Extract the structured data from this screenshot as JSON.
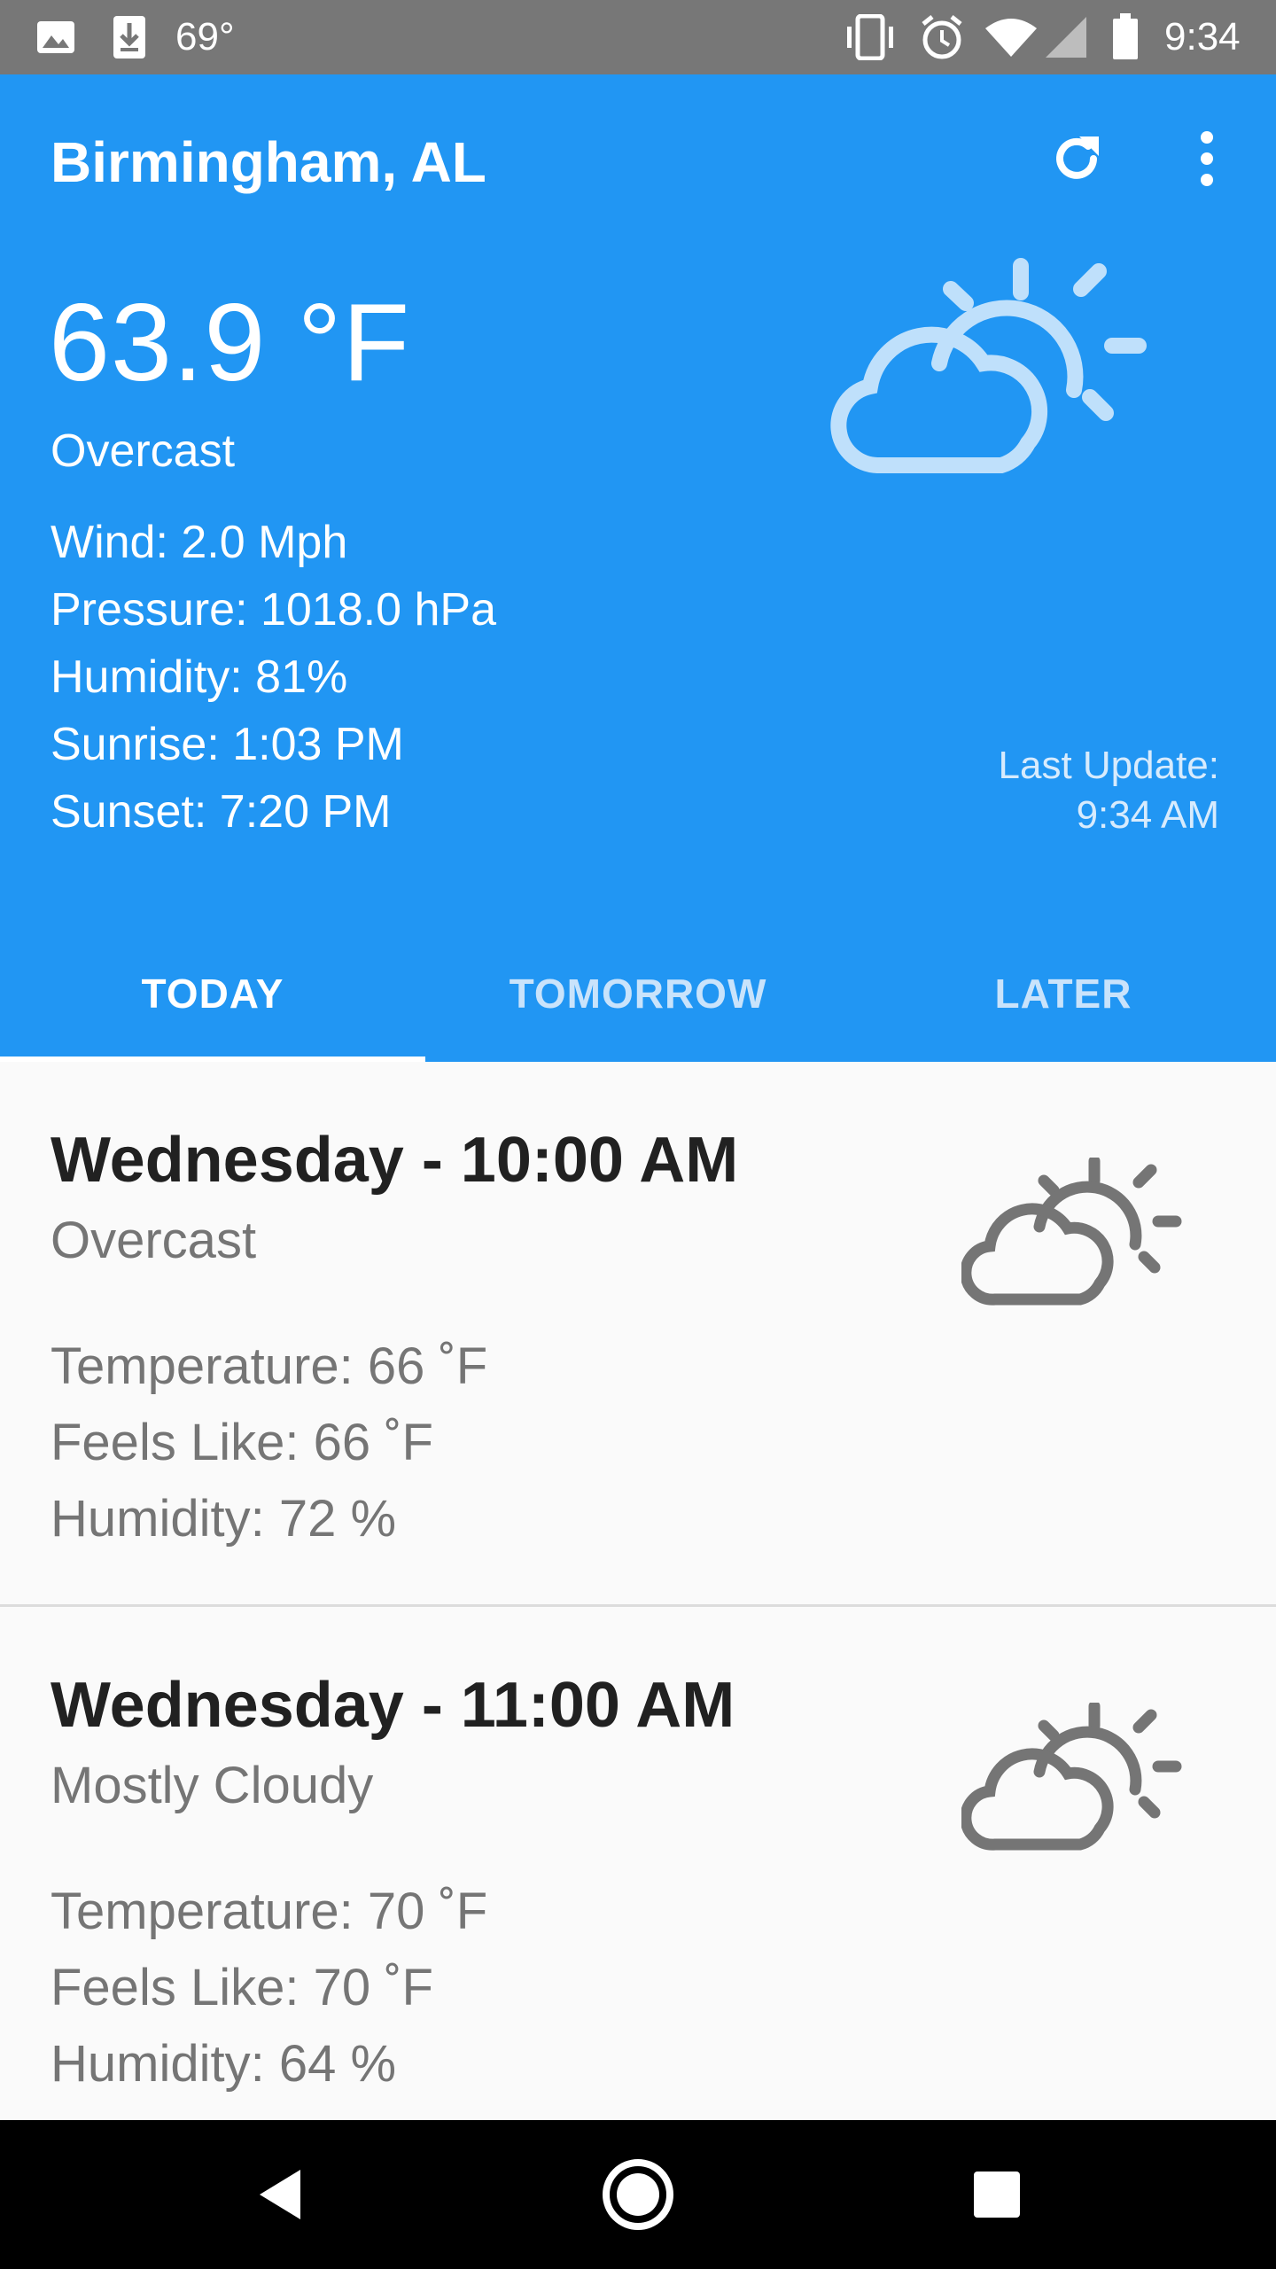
{
  "status_bar": {
    "left_temp": "69°",
    "time": "9:34",
    "icons": [
      "image-icon",
      "download-icon",
      "vibrate-icon",
      "alarm-icon",
      "wifi-icon",
      "signal-icon",
      "battery-icon"
    ]
  },
  "header": {
    "city": "Birmingham, AL",
    "temperature": "63.9 °F",
    "condition": "Overcast",
    "wind": "Wind: 2.0 Mph",
    "pressure": "Pressure: 1018.0 hPa",
    "humidity": "Humidity: 81%",
    "sunrise": "Sunrise: 1:03 PM",
    "sunset": "Sunset: 7:20 PM",
    "last_update_label": "Last Update:",
    "last_update_time": "9:34 AM",
    "accent_color": "#2196f3"
  },
  "tabs": [
    {
      "label": "TODAY",
      "active": true
    },
    {
      "label": "TOMORROW",
      "active": false
    },
    {
      "label": "LATER",
      "active": false
    }
  ],
  "forecast": [
    {
      "title": "Wednesday - 10:00 AM",
      "condition": "Overcast",
      "temperature": "Temperature: 66 ˚F",
      "feels_like": "Feels Like: 66 ˚F",
      "humidity": "Humidity: 72 %",
      "icon": "partly-cloudy-icon"
    },
    {
      "title": "Wednesday - 11:00 AM",
      "condition": "Mostly Cloudy",
      "temperature": "Temperature: 70 ˚F",
      "feels_like": "Feels Like: 70 ˚F",
      "humidity": "Humidity: 64 %",
      "icon": "partly-cloudy-icon"
    }
  ]
}
